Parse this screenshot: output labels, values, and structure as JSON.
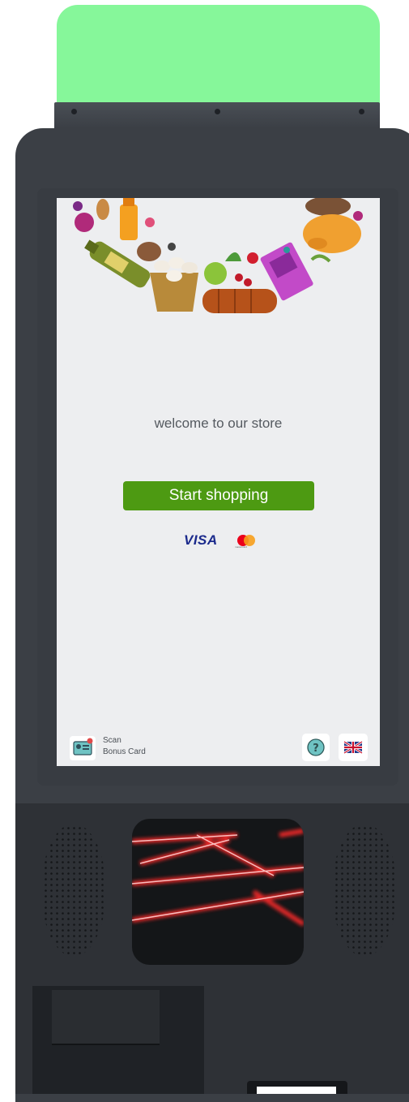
{
  "screen": {
    "welcome_text": "welcome to our store",
    "start_button_label": "Start shopping",
    "payment": {
      "visa_label": "VISA",
      "mastercard_icon": "mastercard-icon",
      "mastercard_caption": "mastercard"
    },
    "scan_card": {
      "line1": "Scan",
      "line2": "Bonus Card",
      "icon": "bonus-card-icon"
    },
    "help_icon": "question-mark-icon",
    "language_icon": "uk-flag-icon"
  },
  "colors": {
    "status_light": "#86f79a",
    "start_button": "#4d9a12",
    "visa_blue": "#1b2a8c",
    "kiosk_body": "#3b3f45",
    "scanner_laser": "#ff2a2a"
  }
}
